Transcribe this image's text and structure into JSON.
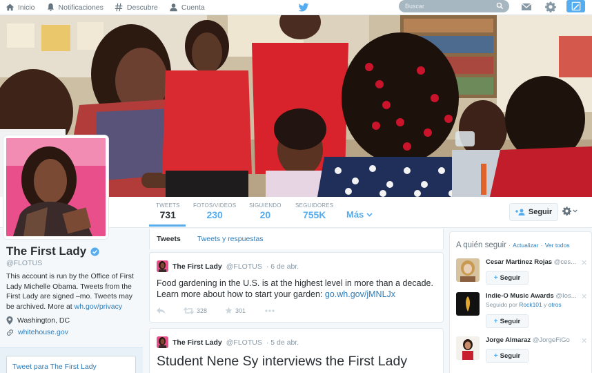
{
  "nav": {
    "home": "Inicio",
    "notifications": "Notificaciones",
    "discover": "Descubre",
    "account": "Cuenta",
    "search_placeholder": "Buscar"
  },
  "profile": {
    "name": "The First Lady",
    "handle": "@FLOTUS",
    "bio_text": "This account is run by the Office of First Lady Michelle Obama. Tweets from the First Lady are signed –mo. Tweets may be archived. More at ",
    "bio_link": "wh.gov/privacy",
    "location": "Washington, DC",
    "website": "whitehouse.gov",
    "tweet_to": "Tweet para The First Lady"
  },
  "stats": [
    {
      "label": "TWEETS",
      "value": "731"
    },
    {
      "label": "FOTOS/VIDEOS",
      "value": "230"
    },
    {
      "label": "SIGUIENDO",
      "value": "20"
    },
    {
      "label": "SEGUIDORES",
      "value": "755K"
    }
  ],
  "more_label": "Más",
  "follow_label": "Seguir",
  "tabs": {
    "tweets": "Tweets",
    "replies": "Tweets y respuestas"
  },
  "tweets": [
    {
      "name": "The First Lady",
      "handle": "@FLOTUS",
      "date": "· 6 de abr.",
      "text": "Food gardening in the U.S. is at the highest level in more than a decade. Learn more about how to start your garden: ",
      "link": "go.wh.gov/jMNLJx",
      "retweets": "328",
      "favorites": "301"
    },
    {
      "name": "The First Lady",
      "handle": "@FLOTUS",
      "date": "· 5 de abr.",
      "text": "Student Nene Sy interviews the First Lady"
    }
  ],
  "who_to_follow": {
    "title": "A quién seguir",
    "refresh": "Actualizar",
    "view_all": "Ver todos",
    "separator": "·",
    "button": "Seguir",
    "items": [
      {
        "name": "Cesar Martinez Rojas",
        "handle": "@ces..."
      },
      {
        "name": "Indie-O Music Awards",
        "handle": "@Ios...",
        "followed_by_prefix": "Seguido por",
        "followed_by": "Rock101",
        "and": "y",
        "others": "otros"
      },
      {
        "name": "Jorge Almaraz",
        "handle": "@JorgeFiGo"
      }
    ]
  },
  "colors": {
    "accent": "#55acee",
    "link": "#2b7bb9",
    "text": "#292f33",
    "muted": "#8899a6",
    "avatar_bg": "#e94f8a"
  }
}
